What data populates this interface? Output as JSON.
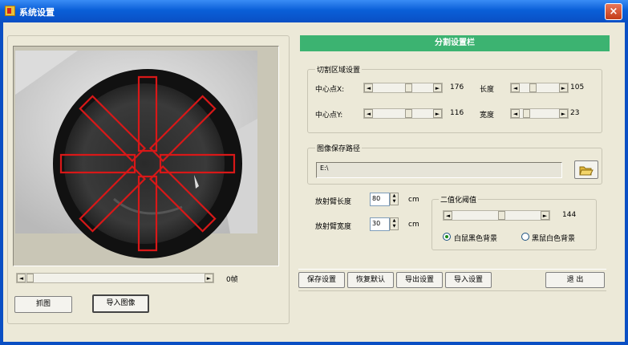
{
  "window": {
    "title": "系统设置",
    "close_label": "×"
  },
  "left_panel": {
    "scroll_value_label": "0帧",
    "buttons": {
      "save_image": "抓图",
      "import_image": "导入图像"
    }
  },
  "right_panel": {
    "header": "分割设置栏",
    "cut_region": {
      "title": "切割区域设置",
      "center_x_label": "中心点X:",
      "center_x_value": "176",
      "center_y_label": "中心点Y:",
      "center_y_value": "116",
      "length_label": "长度",
      "length_value": "105",
      "width_label": "宽度",
      "width_value": "23"
    },
    "save_path": {
      "title": "图像保存路径",
      "value": "E:\\",
      "browse_icon": "folder-open-icon"
    },
    "arm_length": {
      "label": "放射臂长度",
      "value": "80",
      "unit": "cm"
    },
    "arm_width": {
      "label": "放射臂宽度",
      "value": "30",
      "unit": "cm"
    },
    "binarize": {
      "title": "二值化阈值",
      "value": "144",
      "option_black_bg": "白鼠黑色背景",
      "option_white_bg": "黑鼠白色背景",
      "selected": "black_bg"
    },
    "buttons": {
      "save_settings": "保存设置",
      "restore_default": "恢复默认",
      "export_settings": "导出设置",
      "import_settings": "导入设置",
      "exit": "退  出"
    }
  },
  "sliders": {
    "video_frame_fraction": 0.0,
    "center_x_fraction": 0.6,
    "center_y_fraction": 0.6,
    "length_fraction": 0.3,
    "width_fraction": 0.1,
    "binarize_fraction": 0.56
  },
  "colors": {
    "header_green": "#3cb371",
    "arm_outline": "#d81818",
    "title_blue": "#0a5fd8"
  }
}
